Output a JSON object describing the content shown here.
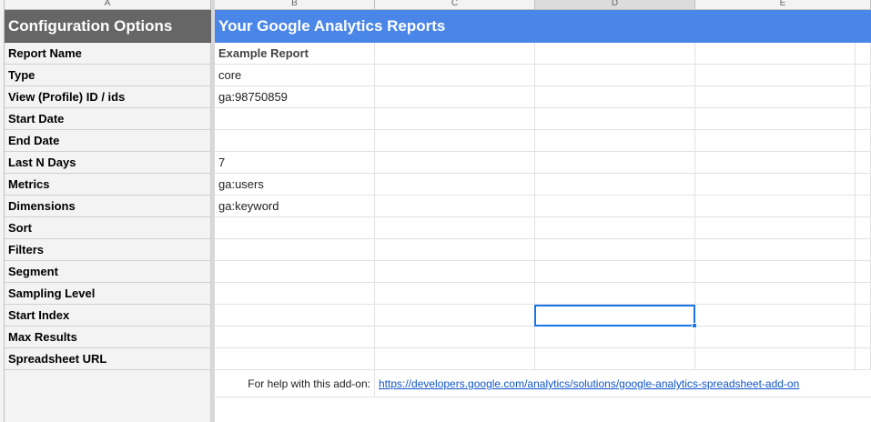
{
  "columns": [
    "A",
    "B",
    "C",
    "D",
    "E"
  ],
  "header": {
    "config_title": "Configuration Options",
    "reports_title": "Your Google Analytics Reports"
  },
  "colors": {
    "config_header_bg": "#666666",
    "reports_header_bg": "#4a86e8",
    "selection": "#1a73e8"
  },
  "rows": [
    {
      "label": "Report Name",
      "value": "Example Report"
    },
    {
      "label": "Type",
      "value": "core"
    },
    {
      "label": "View (Profile) ID / ids",
      "value": "ga:98750859"
    },
    {
      "label": "Start Date",
      "value": ""
    },
    {
      "label": "End Date",
      "value": ""
    },
    {
      "label": "Last N Days",
      "value": "7"
    },
    {
      "label": "Metrics",
      "value": "ga:users"
    },
    {
      "label": "Dimensions",
      "value": "ga:keyword"
    },
    {
      "label": "Sort",
      "value": ""
    },
    {
      "label": "Filters",
      "value": ""
    },
    {
      "label": "Segment",
      "value": ""
    },
    {
      "label": "Sampling Level",
      "value": ""
    },
    {
      "label": "Start Index",
      "value": ""
    },
    {
      "label": "Max Results",
      "value": ""
    },
    {
      "label": "Spreadsheet URL",
      "value": ""
    }
  ],
  "help": {
    "text": "For help with this add-on:",
    "link": "https://developers.google.com/analytics/solutions/google-analytics-spreadsheet-add-on"
  }
}
